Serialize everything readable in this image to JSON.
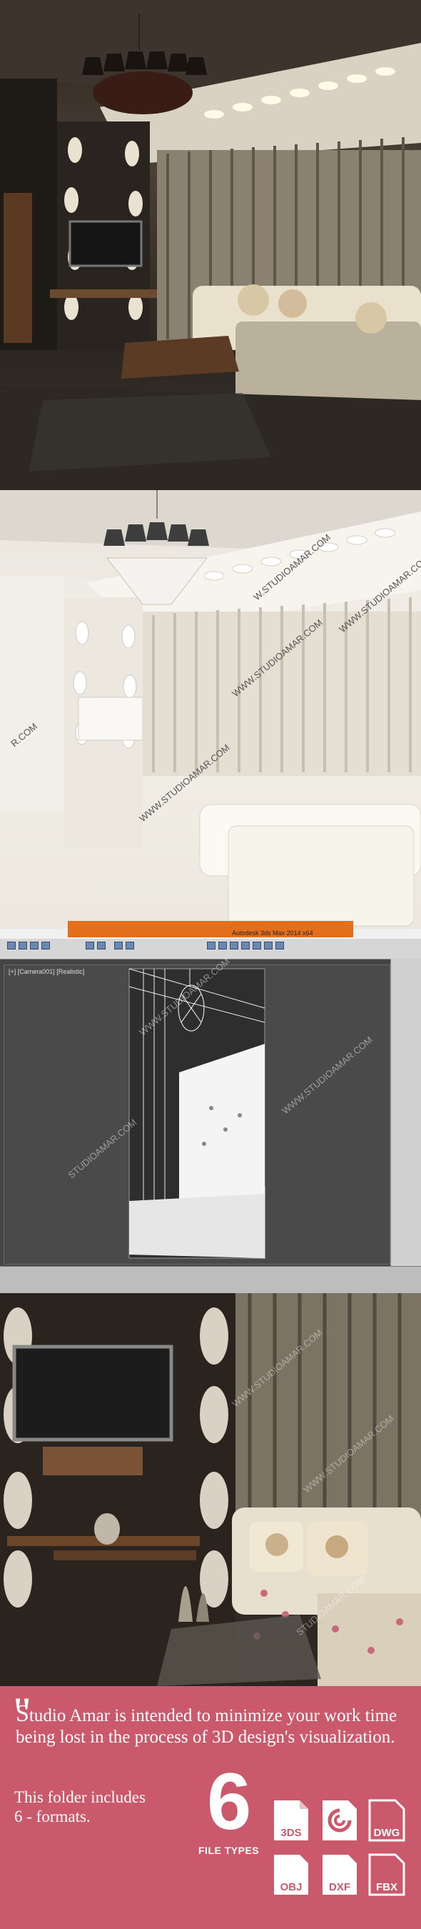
{
  "max_ui": {
    "title": "Autodesk 3ds Max 2014 x64",
    "viewport_label": "[+] [Camera001] [Realistic]"
  },
  "watermarks": [
    "W.STUDIOAMAR.COM",
    "WWW.STUDIOAMAR.COM",
    "R.COM",
    "STUDIOAMAR.COM",
    "W.STUDIC"
  ],
  "banner": {
    "quote": "\"",
    "intro_lead": "S",
    "intro_text": "tudio Amar is intended to minimize your work time being lost in the process of 3D design's visualization.",
    "folder_line1": "This folder includes",
    "folder_line2": "6 - formats.",
    "count": "6",
    "file_types_label": "FILE TYPES",
    "formats": [
      "3DS",
      "MAX",
      "DWG",
      "OBJ",
      "DXF",
      "FBX"
    ]
  },
  "colors": {
    "banner": "#c9596b",
    "max_title_strip": "#e46f1a",
    "wire": "#ffffff"
  }
}
